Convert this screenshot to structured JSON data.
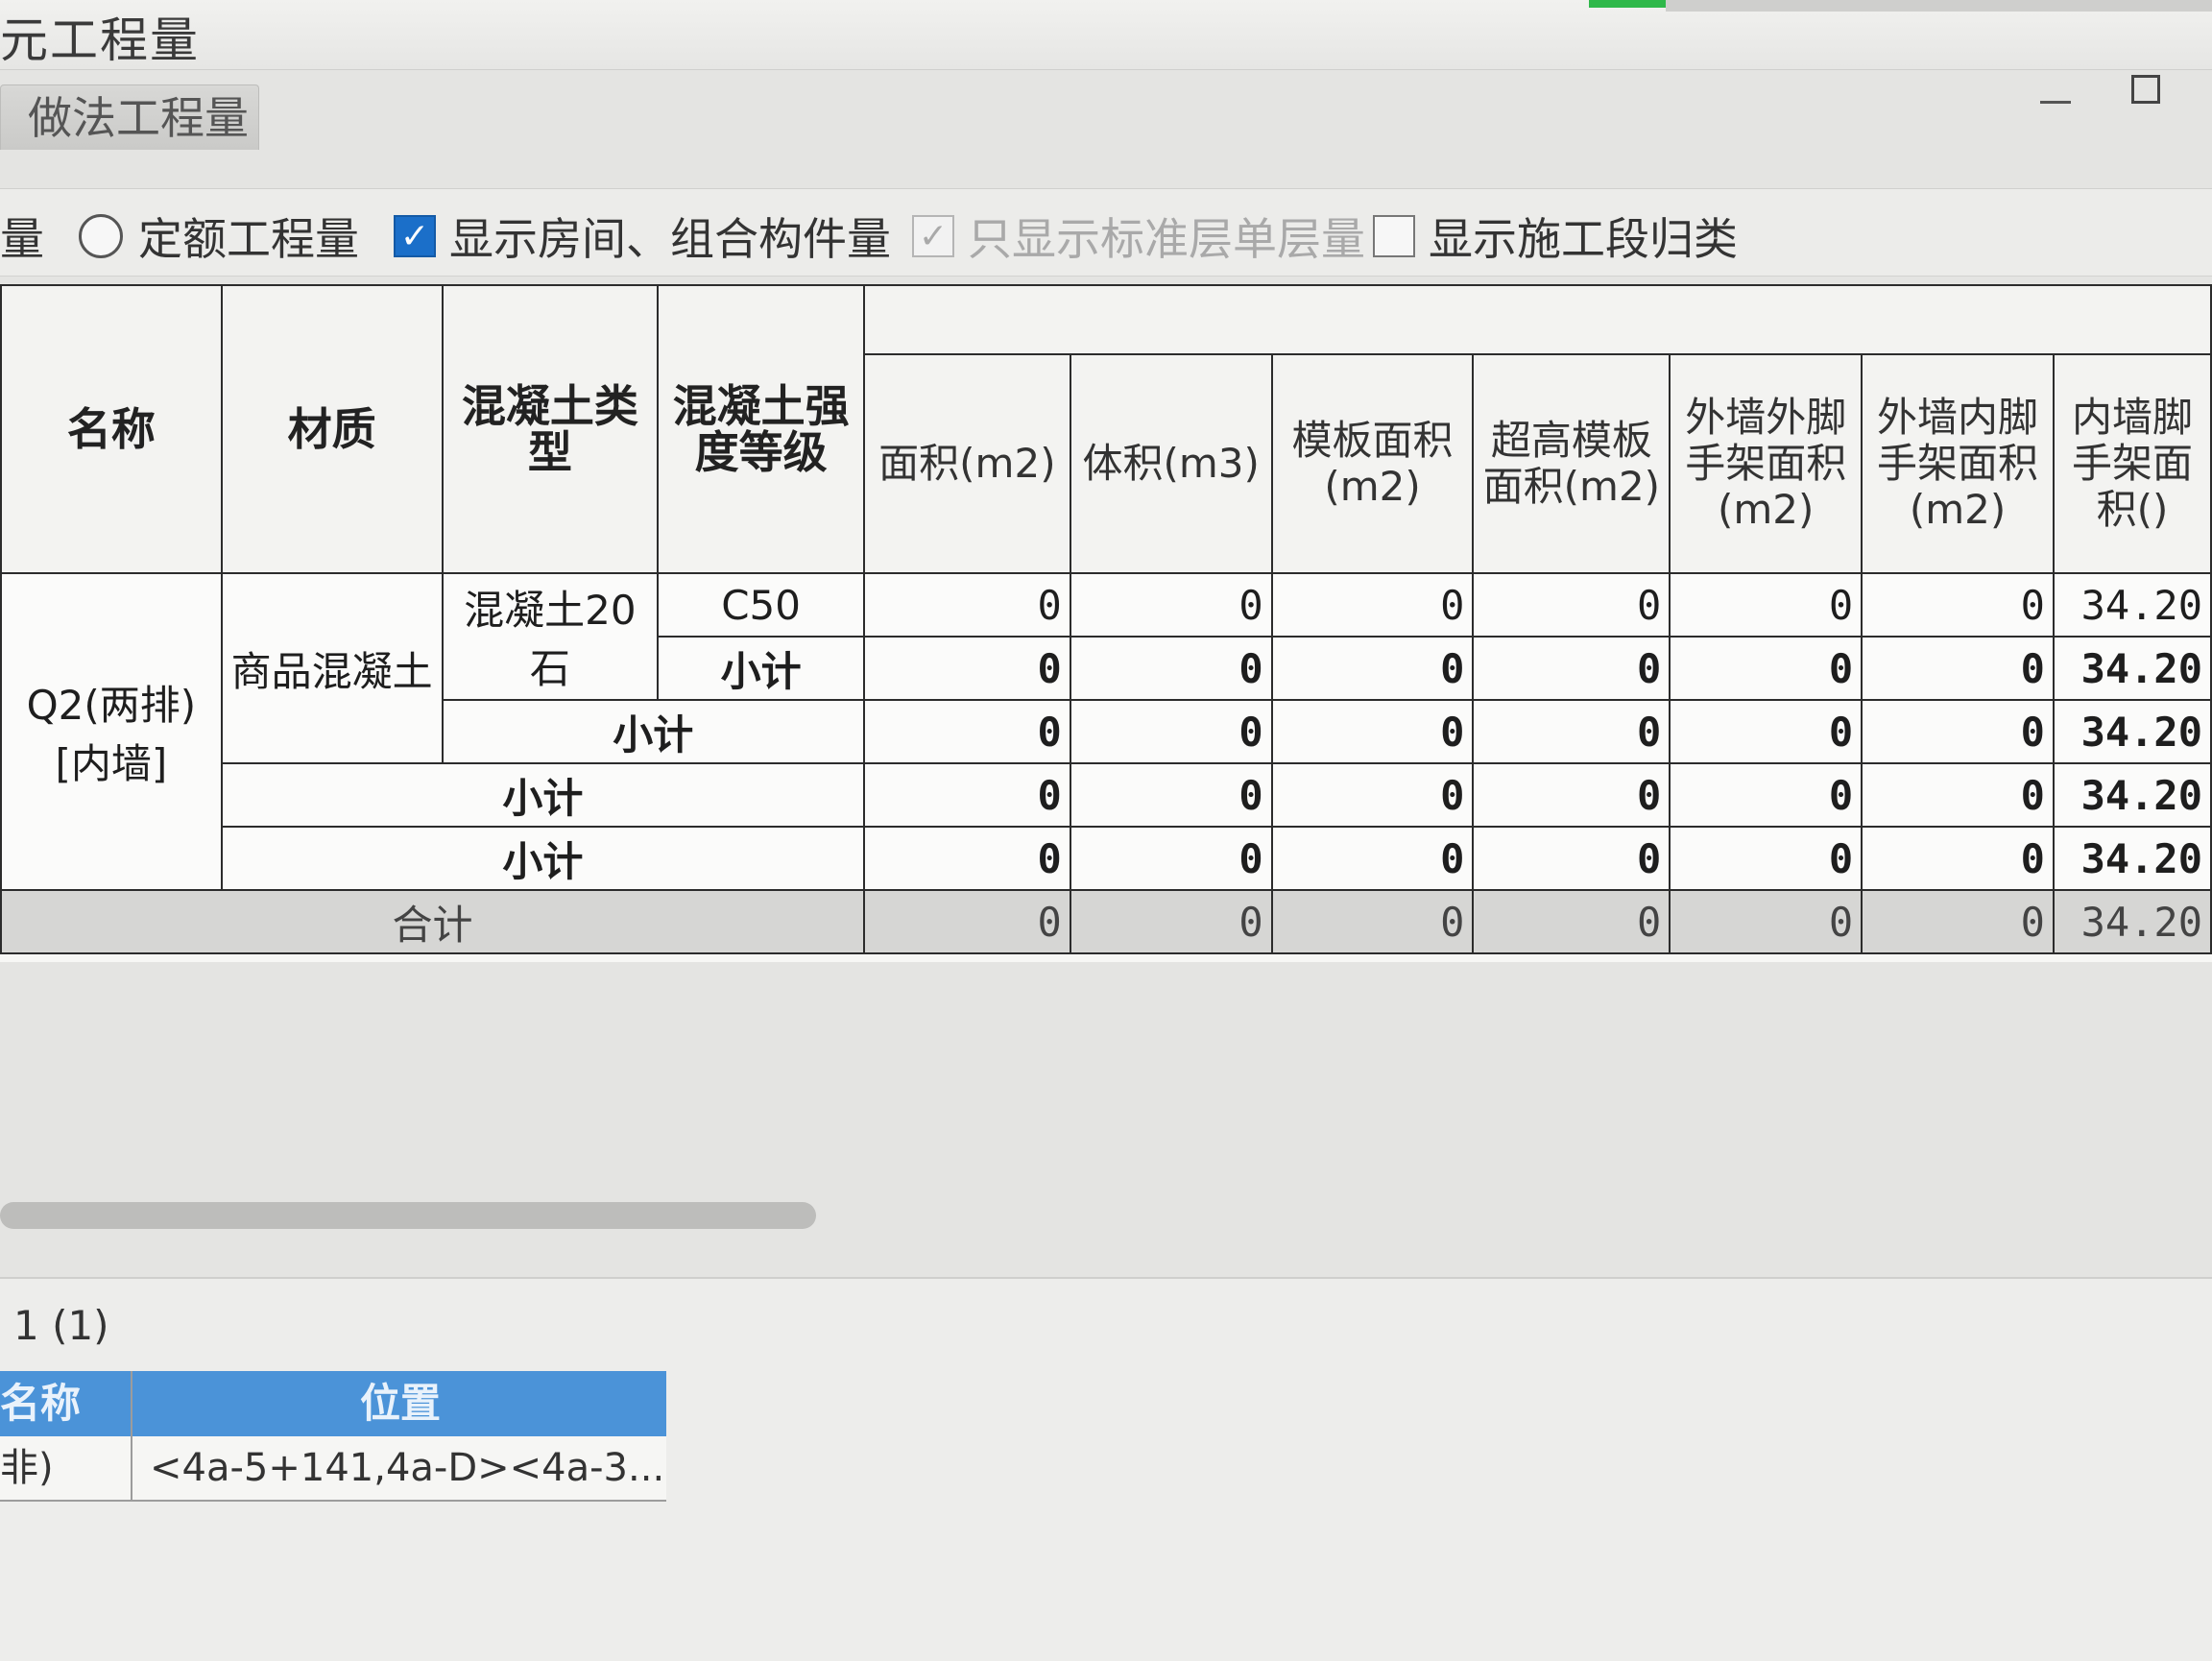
{
  "window": {
    "title": "元工程量",
    "tab_active": "做法工程量"
  },
  "options": {
    "radio_label_left": "量",
    "radio_quota": "定额工程量",
    "check_show_room": "显示房间、组合构件量",
    "check_std_floor": "只显示标准层单层量",
    "check_construction_stage": "显示施工段归类"
  },
  "table": {
    "headers": [
      "名称",
      "材质",
      "混凝土类型",
      "混凝土强度等级",
      "面积(m2)",
      "体积(m3)",
      "模板面积(m2)",
      "超高模板面积(m2)",
      "外墙外脚手架面积(m2)",
      "外墙内脚手架面积(m2)",
      "内墙脚手架面积()"
    ],
    "name_cell": "Q2(两排)[内墙]",
    "material_cell": "商品混凝土",
    "concrete_type_cell": "混凝土20石",
    "grade_cell": "C50",
    "subtotal": "小计",
    "total": "合计",
    "rows": [
      [
        "0",
        "0",
        "0",
        "0",
        "0",
        "0",
        "34.20"
      ],
      [
        "0",
        "0",
        "0",
        "0",
        "0",
        "0",
        "34.20"
      ],
      [
        "0",
        "0",
        "0",
        "0",
        "0",
        "0",
        "34.20"
      ],
      [
        "0",
        "0",
        "0",
        "0",
        "0",
        "0",
        "34.20"
      ],
      [
        "0",
        "0",
        "0",
        "0",
        "0",
        "0",
        "34.20"
      ],
      [
        "0",
        "0",
        "0",
        "0",
        "0",
        "0",
        "34.20"
      ]
    ]
  },
  "bottom": {
    "count_label": "1 (1)",
    "col_name": "名称",
    "col_position": "位置",
    "row_name": "非)",
    "row_position": "<4a-5+141,4a-D><4a-3..."
  }
}
